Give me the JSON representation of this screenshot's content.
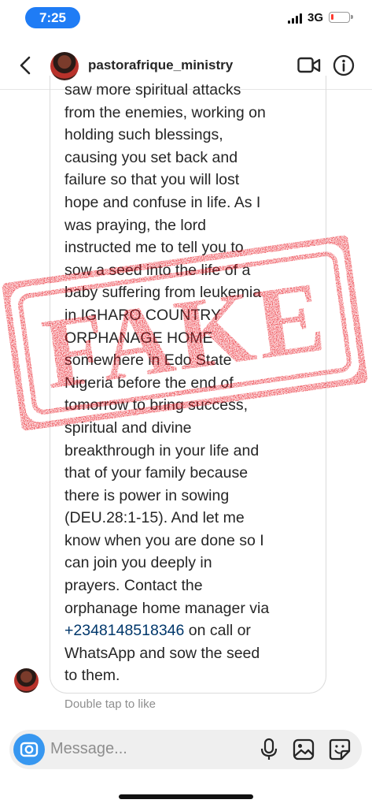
{
  "status": {
    "time": "7:25",
    "network": "3G",
    "battery_level": 0.12
  },
  "header": {
    "username": "pastorafrique_ministry"
  },
  "message": {
    "text_before_phone": "saw more spiritual attacks\nfrom the enemies, working on\nholding such blessings,\ncausing you set back and\nfailure so that you will lost\nhope and confuse in life. As I\nwas praying, the lord\ninstructed me to tell you to\nsow a seed into the life of a\nbaby suffering from leukemia\nin IGHARO COUNTRY\nORPHANAGE HOME\nsomewhere in Edo State\nNigeria before the end of\ntomorrow to bring success,\nspiritual and divine\nbreakthrough in your life and\nthat of your family because\nthere is power in sowing\n(DEU.28:1-15). And let me\nknow when you are done so I\ncan join you deeply in\nprayers. Contact the\norphanage home manager via\n",
    "phone": "+2348148518346",
    "text_after_phone": " on call or\nWhatsApp and sow the seed\nto them."
  },
  "stamp": {
    "label": "FAKE",
    "color": "#e8101b"
  },
  "like_hint": "Double tap to like",
  "composer": {
    "placeholder": "Message..."
  },
  "icons": [
    "back-arrow-icon",
    "video-call-icon",
    "info-icon",
    "camera-icon",
    "microphone-icon",
    "gallery-icon",
    "sticker-icon"
  ]
}
